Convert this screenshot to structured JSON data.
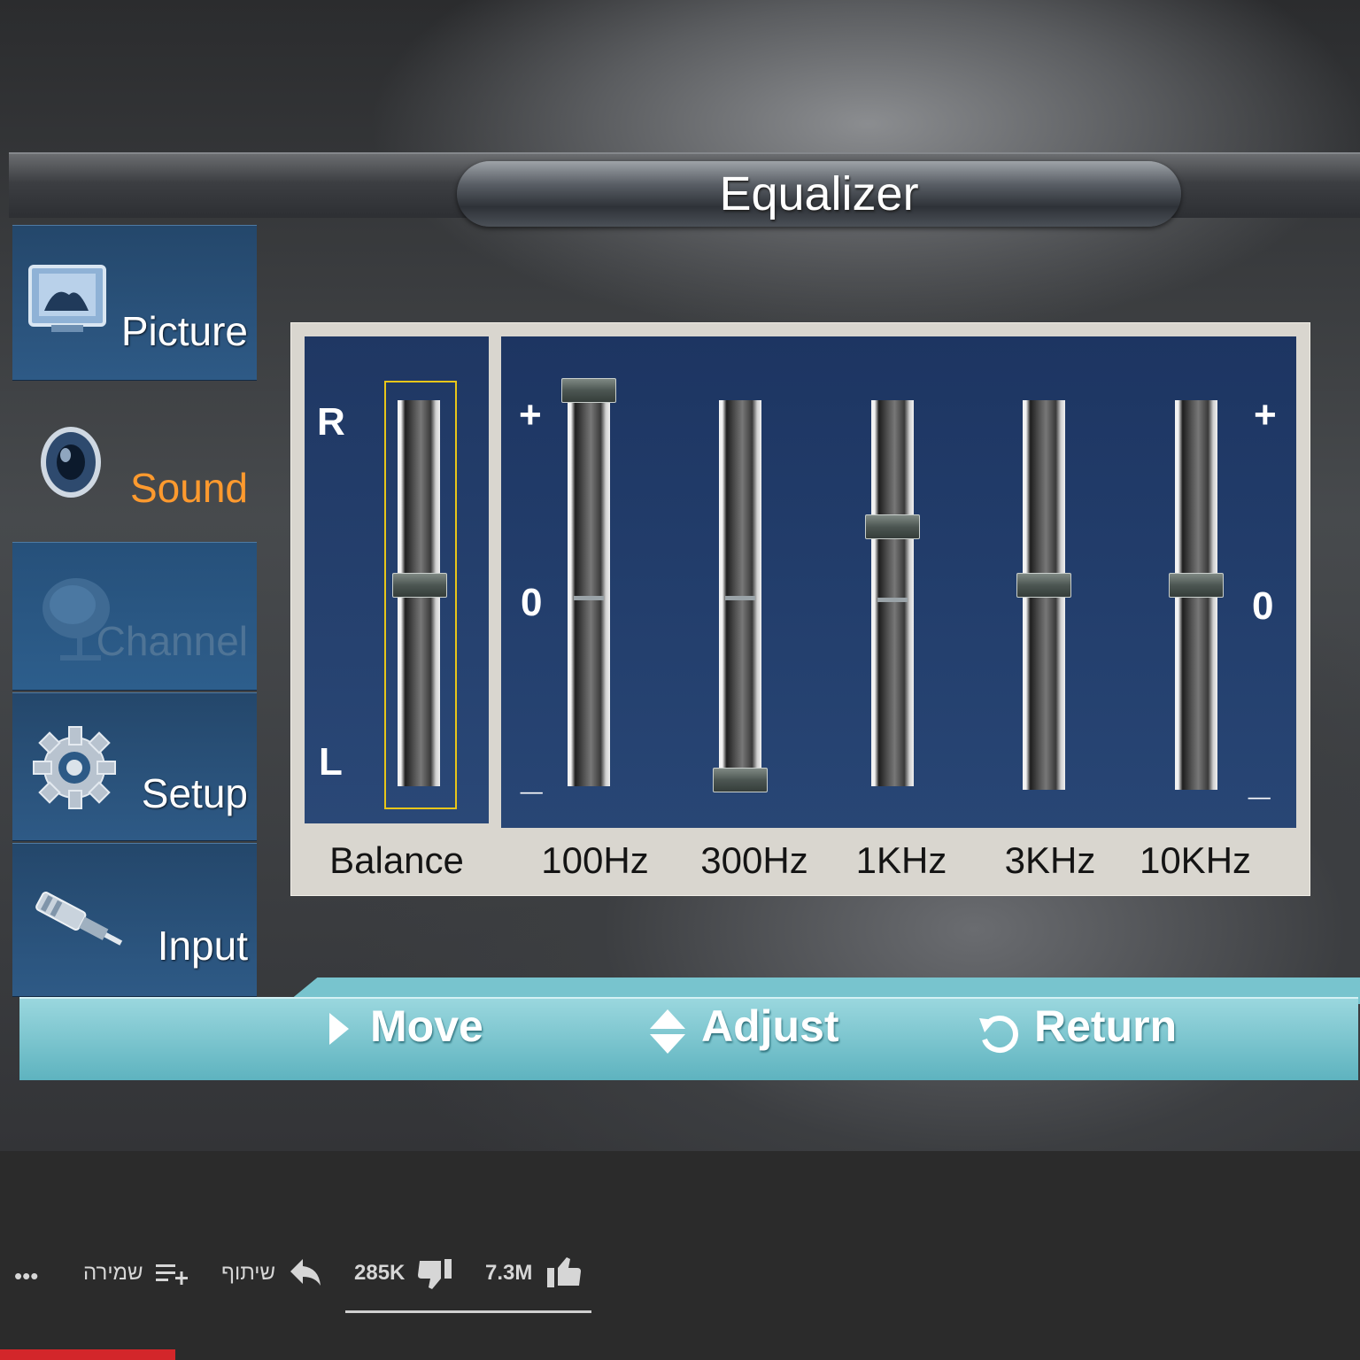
{
  "menu": {
    "title": "Equalizer",
    "nav": [
      {
        "label": "Picture",
        "icon": "picture-icon",
        "state": "normal"
      },
      {
        "label": "Sound",
        "icon": "speaker-icon",
        "state": "active"
      },
      {
        "label": "Channel",
        "icon": "satellite-dish-icon",
        "state": "disabled"
      },
      {
        "label": "Setup",
        "icon": "gear-icon",
        "state": "normal"
      },
      {
        "label": "Input",
        "icon": "rca-plug-icon",
        "state": "normal"
      }
    ]
  },
  "balance": {
    "label": "Balance",
    "top_label": "R",
    "bottom_label": "L",
    "value": 0
  },
  "equalizer": {
    "plus_label": "+",
    "zero_label": "0",
    "minus_label": "_",
    "bands": [
      {
        "label": "100Hz",
        "level": 1.0
      },
      {
        "label": "300Hz",
        "level": -1.0
      },
      {
        "label": "1KHz",
        "level": 0.3
      },
      {
        "label": "3KHz",
        "level": 0.0
      },
      {
        "label": "10KHz",
        "level": 0.0
      }
    ]
  },
  "help": {
    "move": "Move",
    "adjust": "Adjust",
    "return": "Return"
  },
  "youtube_bar": {
    "more": "•••",
    "save": "שמירה",
    "share": "שיתוף",
    "dislikes": "285K",
    "likes": "7.3M"
  },
  "colors": {
    "active_nav": "#ff9a2e",
    "focus_frame": "#e8c619",
    "help_bar": "#6ec1cb",
    "panel_blue": "#243f6e"
  }
}
